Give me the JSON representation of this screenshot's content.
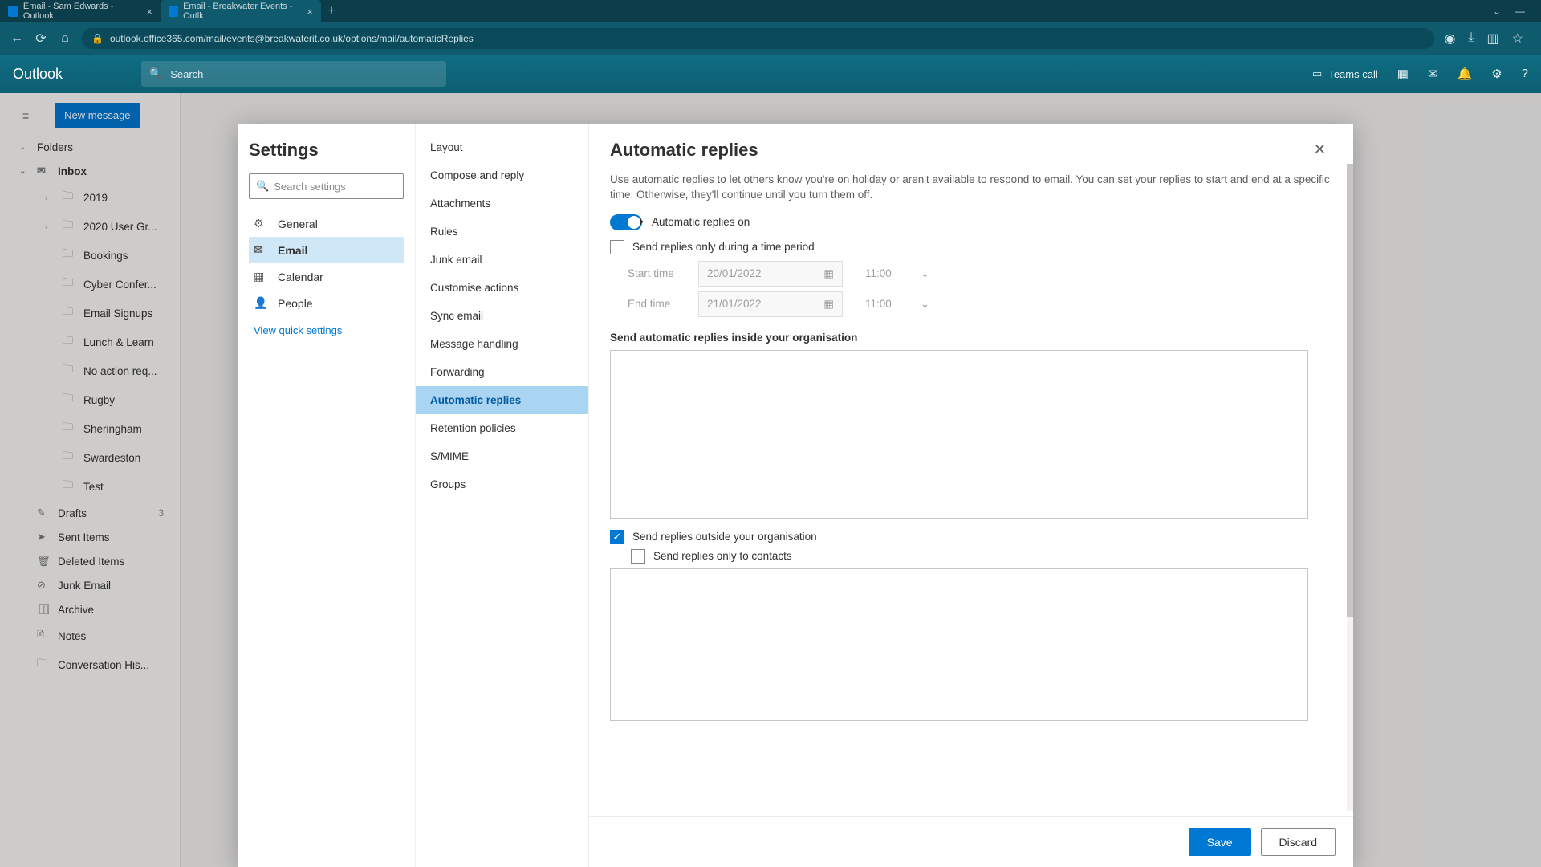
{
  "browser": {
    "tabs": [
      {
        "title": "Email - Sam Edwards - Outlook"
      },
      {
        "title": "Email - Breakwater Events - Outlk"
      }
    ],
    "url": "outlook.office365.com/mail/events@breakwaterit.co.uk/options/mail/automaticReplies"
  },
  "header": {
    "brand": "Outlook",
    "search_placeholder": "Search",
    "teams_call": "Teams call"
  },
  "mailbox": {
    "new_message": "New message",
    "folders_label": "Folders",
    "inbox": "Inbox",
    "items": [
      "2019",
      "2020 User Gr...",
      "Bookings",
      "Cyber Confer...",
      "Email Signups",
      "Lunch & Learn",
      "No action req...",
      "Rugby",
      "Sheringham",
      "Swardeston",
      "Test"
    ],
    "drafts": "Drafts",
    "drafts_count": "3",
    "sent": "Sent Items",
    "deleted": "Deleted Items",
    "junk": "Junk Email",
    "archive": "Archive",
    "notes": "Notes",
    "convo": "Conversation His..."
  },
  "settings": {
    "title": "Settings",
    "search_placeholder": "Search settings",
    "cats": [
      "General",
      "Email",
      "Calendar",
      "People"
    ],
    "quick_link": "View quick settings",
    "subs": [
      "Layout",
      "Compose and reply",
      "Attachments",
      "Rules",
      "Junk email",
      "Customise actions",
      "Sync email",
      "Message handling",
      "Forwarding",
      "Automatic replies",
      "Retention policies",
      "S/MIME",
      "Groups"
    ]
  },
  "panel": {
    "title": "Automatic replies",
    "desc": "Use automatic replies to let others know you're on holiday or aren't available to respond to email. You can set your replies to start and end at a specific time. Otherwise, they'll continue until you turn them off.",
    "toggle_label": "Automatic replies on",
    "time_period_label": "Send replies only during a time period",
    "start_label": "Start time",
    "end_label": "End time",
    "start_date": "20/01/2022",
    "end_date": "21/01/2022",
    "start_time": "11:00",
    "end_time": "11:00",
    "inside_label": "Send automatic replies inside your organisation",
    "outside_label": "Send replies outside your organisation",
    "contacts_label": "Send replies only to contacts",
    "save": "Save",
    "discard": "Discard"
  }
}
